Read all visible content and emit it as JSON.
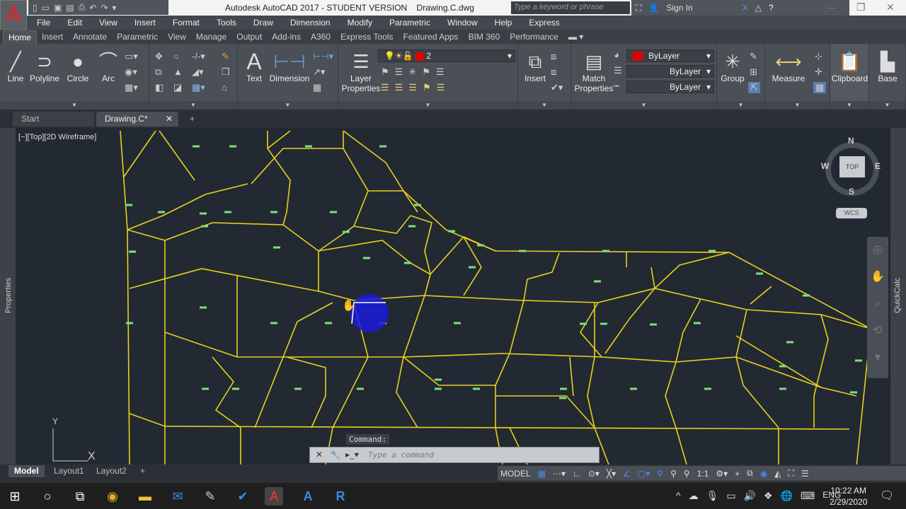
{
  "app": {
    "logo": "A",
    "title": "Autodesk AutoCAD 2017 - STUDENT VERSION    Drawing.C.dwg",
    "search_placeholder": "Type a keyword or phrase",
    "sign_in": "Sign In"
  },
  "menu": [
    "File",
    "Edit",
    "View",
    "Insert",
    "Format",
    "Tools",
    "Draw",
    "Dimension",
    "Modify",
    "Parametric",
    "Window",
    "Help",
    "Express"
  ],
  "ribbon_tabs": [
    "Home",
    "Insert",
    "Annotate",
    "Parametric",
    "View",
    "Manage",
    "Output",
    "Add-ins",
    "A360",
    "Express Tools",
    "Featured Apps",
    "BIM 360",
    "Performance"
  ],
  "ribbon": {
    "line": "Line",
    "polyline": "Polyline",
    "circle": "Circle",
    "arc": "Arc",
    "text": "Text",
    "dimension": "Dimension",
    "layer_properties_1": "Layer",
    "layer_properties_2": "Properties",
    "layer_value": "2",
    "insert": "Insert",
    "match_1": "Match",
    "match_2": "Properties",
    "color": "ByLayer",
    "linetype": "ByLayer",
    "lineweight": "ByLayer",
    "group": "Group",
    "measure": "Measure",
    "clipboard": "Clipboard",
    "base": "Base"
  },
  "file_tabs": [
    "Start",
    "Drawing.C*"
  ],
  "viewport_label": "[−][Top][2D Wireframe]",
  "viewcube": {
    "n": "N",
    "s": "S",
    "e": "E",
    "w": "W",
    "top": "TOP",
    "wcs": "WCS"
  },
  "ucs": {
    "x": "X",
    "y": "Y"
  },
  "command": {
    "label": "Command:",
    "placeholder": "Type a command"
  },
  "side": {
    "left": "Properties",
    "right": "QuickCalc"
  },
  "layout_tabs": [
    "Model",
    "Layout1",
    "Layout2"
  ],
  "status": {
    "model": "MODEL",
    "scale": "1:1"
  },
  "tray": {
    "lang": "ENG",
    "time": "10:22 AM",
    "date": "2/29/2020"
  },
  "colors": {
    "lines": "#e8d21a",
    "marks": "#7ee07a",
    "canvas": "#222933",
    "cursor_circle": "#1a1adc",
    "layer_color": "#e00000"
  }
}
